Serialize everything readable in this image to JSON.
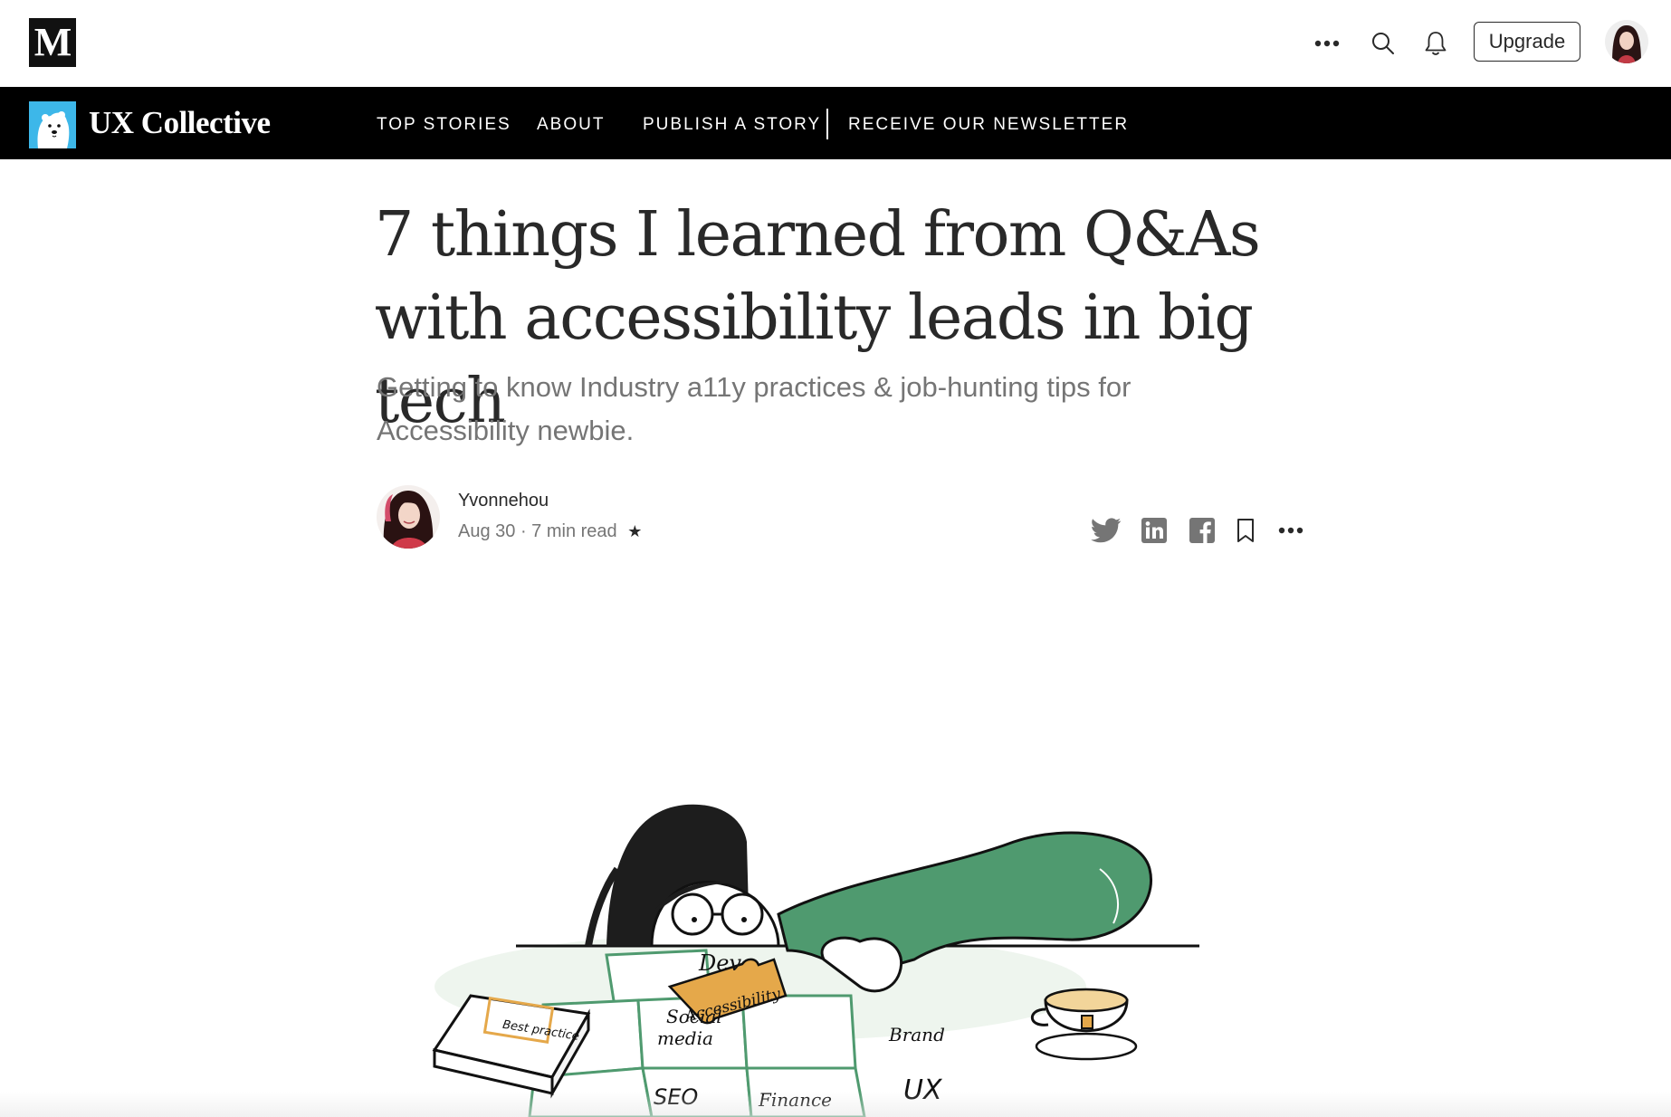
{
  "app": {
    "logo_letter": "M",
    "upgrade_label": "Upgrade",
    "icons": [
      "more-icon",
      "search-icon",
      "bell-icon",
      "avatar"
    ]
  },
  "publication": {
    "name": "UX Collective",
    "nav": [
      "TOP STORIES",
      "ABOUT",
      "PUBLISH A STORY",
      "RECEIVE OUR NEWSLETTER"
    ]
  },
  "article": {
    "title_line1": "7 things I learned from Q&As",
    "title_line2": "with accessibility leads in big tech",
    "subtitle_line1": "Getting to know Industry a11y practices & job-hunting tips for",
    "subtitle_line2": "Accessibility newbie.",
    "author": "Yvonnehou",
    "date": "Aug 30",
    "read_time": "7 min read",
    "member_star": "★",
    "share_icons": [
      "twitter-icon",
      "linkedin-icon",
      "facebook-icon",
      "bookmark-icon",
      "more-icon"
    ]
  },
  "illustration": {
    "labels": {
      "book": "Best practice",
      "dev": "Dev",
      "piece": "Accessibility",
      "social1": "Social",
      "social2": "media",
      "brand": "Brand",
      "seo": "SEO",
      "finance": "Finance",
      "ux": "UX"
    }
  },
  "colors": {
    "nav_bg": "#000000",
    "green": "#4f9a6f",
    "gold": "#e5a84a",
    "text": "#292929",
    "muted": "#757575"
  }
}
